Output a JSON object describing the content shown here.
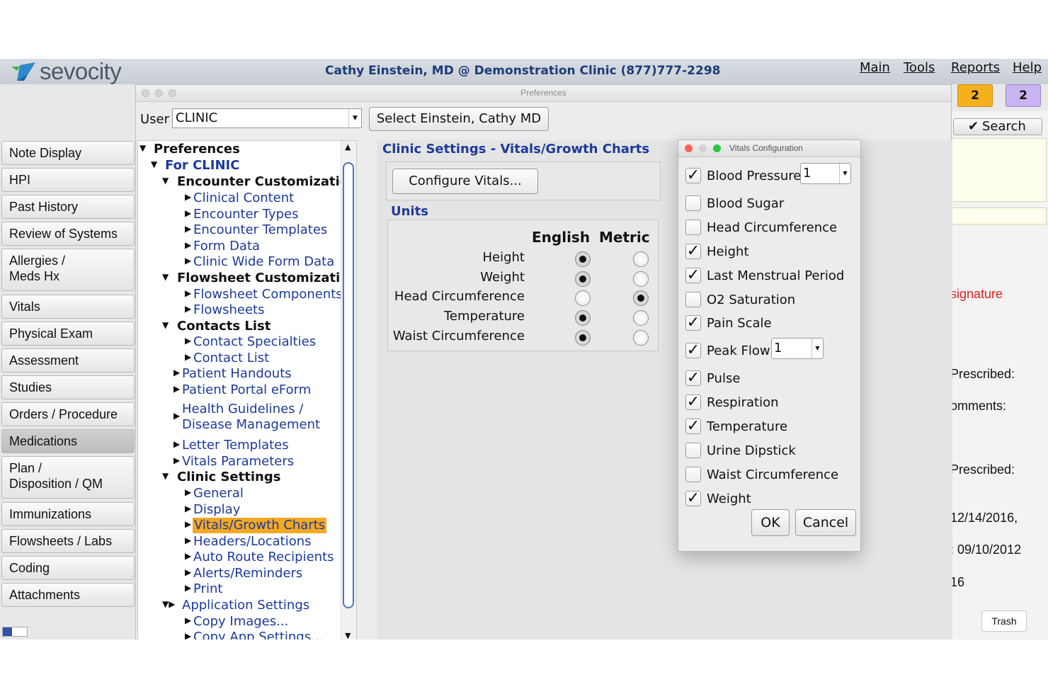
{
  "app": {
    "logo_text": "sevocity",
    "clinic_title": "Cathy Einstein, MD @ Demonstration Clinic (877)777-2298",
    "menu": [
      "Main",
      "Tools",
      "Reports",
      "Help"
    ],
    "badges": [
      "2",
      "2"
    ],
    "search_label": "Search"
  },
  "left_nav": {
    "items": [
      {
        "label": "Note Display"
      },
      {
        "label": "HPI"
      },
      {
        "label": "Past History"
      },
      {
        "label": "Review of Systems"
      },
      {
        "label": "Allergies /\nMeds Hx"
      },
      {
        "label": "Vitals"
      },
      {
        "label": "Physical Exam"
      },
      {
        "label": "Assessment"
      },
      {
        "label": "Studies"
      },
      {
        "label": "Orders / Procedure"
      },
      {
        "label": "Medications",
        "active": true
      },
      {
        "label": "Plan /\nDisposition / QM"
      },
      {
        "label": "Immunizations"
      },
      {
        "label": "Flowsheets / Labs"
      },
      {
        "label": "Coding"
      },
      {
        "label": "Attachments"
      }
    ]
  },
  "preferences_window": {
    "title": "Preferences",
    "user_label": "User",
    "user_value": "CLINIC",
    "select_button": "Select Einstein, Cathy MD",
    "tree": {
      "root": "Preferences",
      "for_clinic": "For CLINIC",
      "encounter_customizations": "Encounter Customizations",
      "clinical_content": "Clinical Content",
      "encounter_types": "Encounter Types",
      "encounter_templates": "Encounter Templates",
      "form_data": "Form Data",
      "clinic_wide_form_data": "Clinic Wide Form Data",
      "flowsheet_customizations": "Flowsheet Customizations",
      "flowsheet_components": "Flowsheet Components",
      "flowsheets": "Flowsheets",
      "contacts_list": "Contacts List",
      "contact_specialties": "Contact Specialties",
      "contact_list": "Contact List",
      "patient_handouts": "Patient Handouts",
      "patient_portal_eform": "Patient Portal eForm",
      "health_guidelines_1": "Health Guidelines /",
      "health_guidelines_2": "Disease Management",
      "letter_templates": "Letter Templates",
      "vitals_parameters": "Vitals Parameters",
      "clinic_settings": "Clinic Settings",
      "general": "General",
      "display": "Display",
      "vitals_growth_charts": "Vitals/Growth Charts",
      "headers_locations": "Headers/Locations",
      "auto_route_recipients": "Auto Route Recipients",
      "alerts_reminders": "Alerts/Reminders",
      "print": "Print",
      "application_settings": "Application Settings",
      "copy_images": "Copy Images...",
      "copy_app_settings": "Copy App Settings..."
    },
    "content": {
      "title": "Clinic Settings - Vitals/Growth Charts",
      "configure_button": "Configure Vitals...",
      "units_label": "Units",
      "col_english": "English",
      "col_metric": "Metric",
      "units": [
        {
          "label": "Height",
          "selected": "english"
        },
        {
          "label": "Weight",
          "selected": "english"
        },
        {
          "label": "Head Circumference",
          "selected": "metric"
        },
        {
          "label": "Temperature",
          "selected": "english"
        },
        {
          "label": "Waist Circumference",
          "selected": "english"
        }
      ]
    }
  },
  "vitals_dialog": {
    "title": "Vitals Configuration",
    "items": [
      {
        "label": "Blood Pressure",
        "checked": true,
        "count": "1"
      },
      {
        "label": "Blood Sugar",
        "checked": false
      },
      {
        "label": "Head Circumference",
        "checked": false
      },
      {
        "label": "Height",
        "checked": true
      },
      {
        "label": "Last Menstrual Period",
        "checked": true
      },
      {
        "label": "O2 Saturation",
        "checked": false
      },
      {
        "label": "Pain Scale",
        "checked": true
      },
      {
        "label": "Peak Flow",
        "checked": true,
        "count": "1"
      },
      {
        "label": "Pulse",
        "checked": true
      },
      {
        "label": "Respiration",
        "checked": true
      },
      {
        "label": "Temperature",
        "checked": true
      },
      {
        "label": "Urine Dipstick",
        "checked": false
      },
      {
        "label": "Waist Circumference",
        "checked": false
      },
      {
        "label": "Weight",
        "checked": true
      }
    ],
    "ok": "OK",
    "cancel": "Cancel"
  },
  "right_panel": {
    "signature": "signature",
    "prescribed_1": "Prescribed:",
    "comments": "omments:",
    "prescribed_2": "Prescribed:",
    "date_1": "12/14/2016,",
    "date_2": ": 09/10/2012",
    "frag": "16",
    "trash": "Trash"
  },
  "colors": {
    "accent_blue": "#1c3a9a",
    "selection": "#f4a923",
    "signature_red": "#e02020",
    "badge_orange": "#f4b01e",
    "badge_purple": "#c9b3f0"
  }
}
